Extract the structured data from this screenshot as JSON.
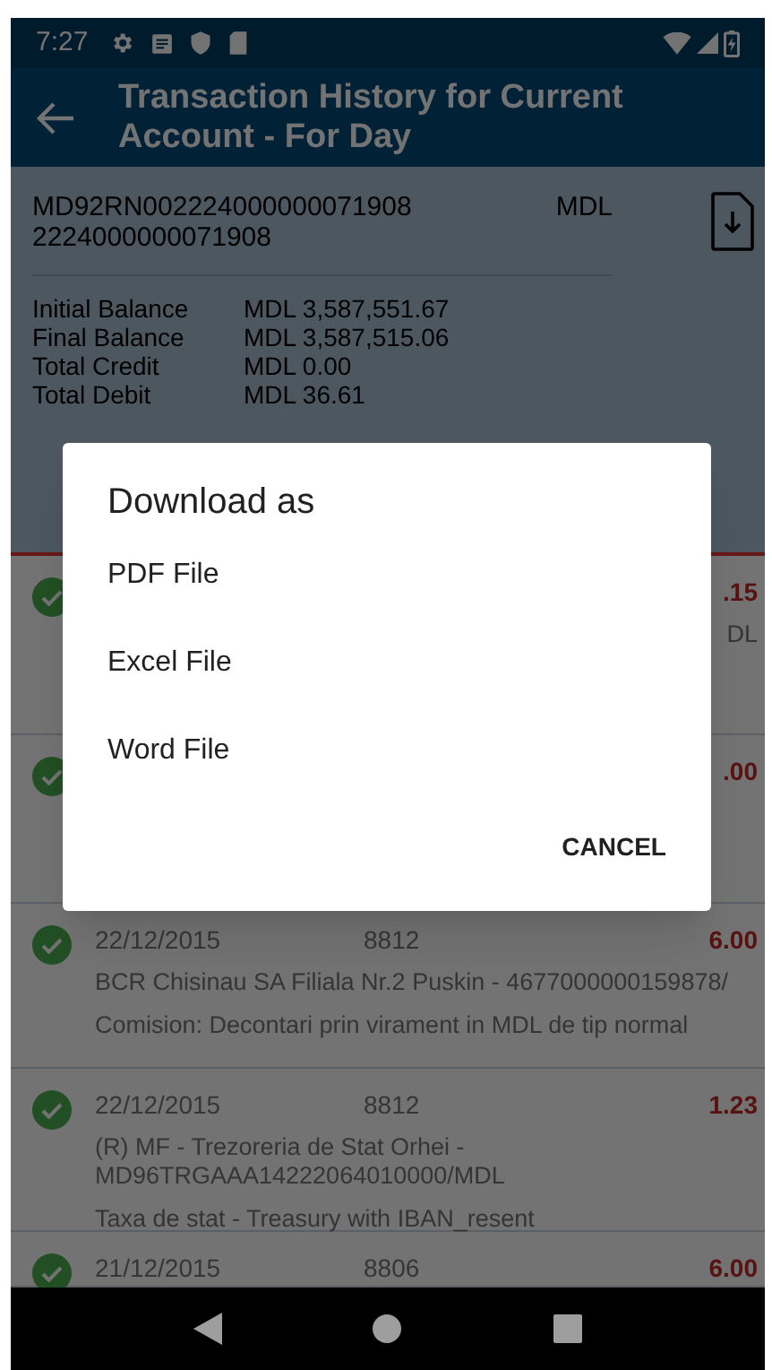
{
  "status_bar": {
    "time": "7:27"
  },
  "toolbar": {
    "title": "Transaction History for Current Account - For Day"
  },
  "account": {
    "iban": "MD92RN002224000000071908",
    "currency": "MDL",
    "number": "2224000000071908",
    "balances": [
      {
        "label": "Initial Balance",
        "value": "MDL 3,587,551.67"
      },
      {
        "label": "Final Balance",
        "value": "MDL 3,587,515.06"
      },
      {
        "label": "Total Credit",
        "value": "MDL 0.00"
      },
      {
        "label": "Total Debit",
        "value": "MDL 36.61"
      }
    ]
  },
  "transactions": [
    {
      "amount": ".15",
      "lines": [
        "DL"
      ]
    },
    {
      "amount": ".00"
    },
    {
      "date": "22/12/2015",
      "reference": "8812",
      "amount": "6.00",
      "lines": [
        "BCR Chisinau SA Filiala Nr.2 Puskin  - 4677000000159878/",
        "Comision: Decontari prin virament in MDL de tip normal"
      ]
    },
    {
      "date": "22/12/2015",
      "reference": "8812",
      "amount": "1.23",
      "lines": [
        "(R) MF - Trezoreria de Stat Orhei - MD96TRGAAA14222064010000/MDL",
        "Taxa de stat - Treasury with IBAN_resent"
      ]
    },
    {
      "date": "21/12/2015",
      "reference": "8806",
      "amount": "6.00"
    }
  ],
  "dialog": {
    "title": "Download as",
    "options": [
      "PDF File",
      "Excel File",
      "Word File"
    ],
    "button": "CANCEL"
  }
}
